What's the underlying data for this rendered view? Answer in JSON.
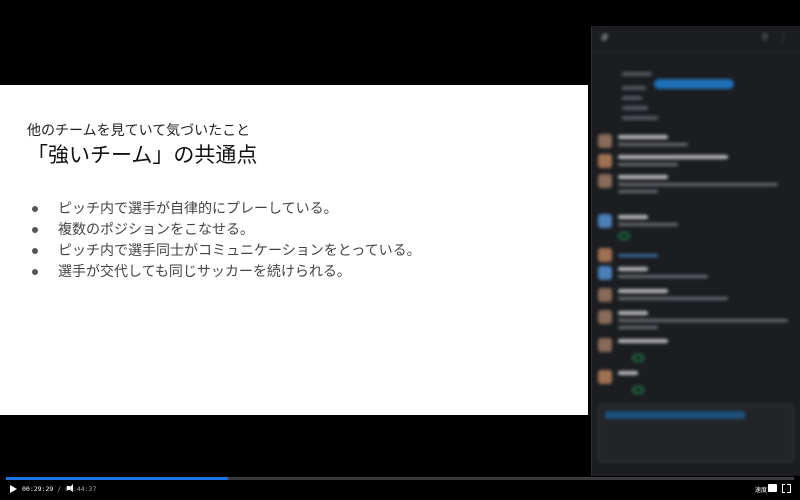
{
  "slide": {
    "subtitle": "他のチームを見ていて気づいたこと",
    "title": "「強いチーム」の共通点",
    "bullets": [
      "ピッチ内で選手が自律的にプレーしている。",
      "複数のポジションをこなせる。",
      "ピッチ内で選手同士がコミュニケーションをとっている。",
      "選手が交代しても同じサッカーを続けられる。"
    ]
  },
  "player": {
    "current_time": "00:29:29",
    "separator": "/",
    "duration": "01:44:37",
    "speed_label": "速度",
    "progress_fraction": 0.282,
    "accent_color": "#1a73e8"
  },
  "chat_panel": {
    "icons": [
      "hash-icon",
      "search-icon",
      "more-icon"
    ]
  }
}
